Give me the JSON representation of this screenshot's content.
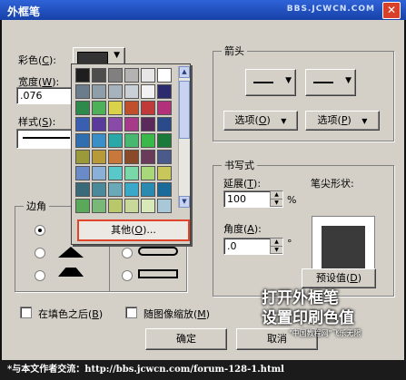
{
  "window": {
    "title": "外框笔",
    "watermark": "BBS.JCWCN.COM",
    "close_glyph": "✕"
  },
  "color": {
    "label": "彩色(",
    "key": "C",
    "suffix": "):",
    "value_hex": "#333333"
  },
  "width": {
    "label": "宽度(",
    "key": "W",
    "suffix": "):",
    "value": ".076"
  },
  "style": {
    "label": "样式(",
    "key": "S",
    "suffix": "):"
  },
  "corners": {
    "label": "边角"
  },
  "palette": {
    "colors": [
      "#1e1e1e",
      "#4d4d4d",
      "#808080",
      "#b3b3b3",
      "#e6e6e6",
      "#ffffff",
      "#6b7d8c",
      "#8f9fa9",
      "#a7b3bc",
      "#c9d0d6",
      "#f2f2f2",
      "#2b2b6e",
      "#2e8a4a",
      "#4fb05a",
      "#d9d24a",
      "#c0502c",
      "#c13a3a",
      "#b3307a",
      "#3a5fb0",
      "#5a3a9a",
      "#8a4aa8",
      "#a83a8a",
      "#5a2a5a",
      "#2a4a8a",
      "#2f6fb0",
      "#3a8fc8",
      "#2aa8a8",
      "#48b870",
      "#3ab84a",
      "#1a7a3a",
      "#9a9a3a",
      "#b89a3a",
      "#c8783a",
      "#8a4a2a",
      "#6a3a5a",
      "#4a5a8a",
      "#6a8ac8",
      "#8ab0d8",
      "#5ac8c8",
      "#7ad8a8",
      "#a8d87a",
      "#c8c85a",
      "#3a6a7a",
      "#4a8a9a",
      "#6aaab8",
      "#3aa8c8",
      "#2a8ab0",
      "#1a6a9a",
      "#5aa85a",
      "#7ab87a",
      "#b8c86a",
      "#c8d89a",
      "#d8e8b8",
      "#a8c8d8"
    ],
    "other_label": "其他(",
    "other_key": "O",
    "other_suffix": ")..."
  },
  "arrows": {
    "label": "箭头",
    "options_left": "选项(",
    "options_left_key": "O",
    "options_right": "选项(",
    "options_right_key": "P",
    "options_suffix": ")"
  },
  "calligraphy": {
    "label": "书写式",
    "stretch_label": "延展(",
    "stretch_key": "T",
    "stretch_suffix": "):",
    "stretch_value": "100",
    "stretch_unit": "%",
    "angle_label": "角度(",
    "angle_key": "A",
    "angle_suffix": "):",
    "angle_value": ".0",
    "angle_unit": "°",
    "nib_label": "笔尖形状:",
    "default_label": "预设值(",
    "default_key": "D",
    "default_suffix": ")"
  },
  "options": {
    "behind_fill": "在填色之后(",
    "behind_fill_key": "B",
    "scale_with_image": "随图像缩放(",
    "scale_key": "M",
    "close_paren": ")"
  },
  "buttons": {
    "ok": "确定",
    "cancel": "取消"
  },
  "overlay": {
    "line1": "打开外框笔",
    "line2": "设置印刷色值",
    "brand": "\"中国教程网\"飞乐无限"
  },
  "footer": {
    "text": "*与本文作者交流：http://bbs.jcwcn.com/forum-128-1.html"
  }
}
